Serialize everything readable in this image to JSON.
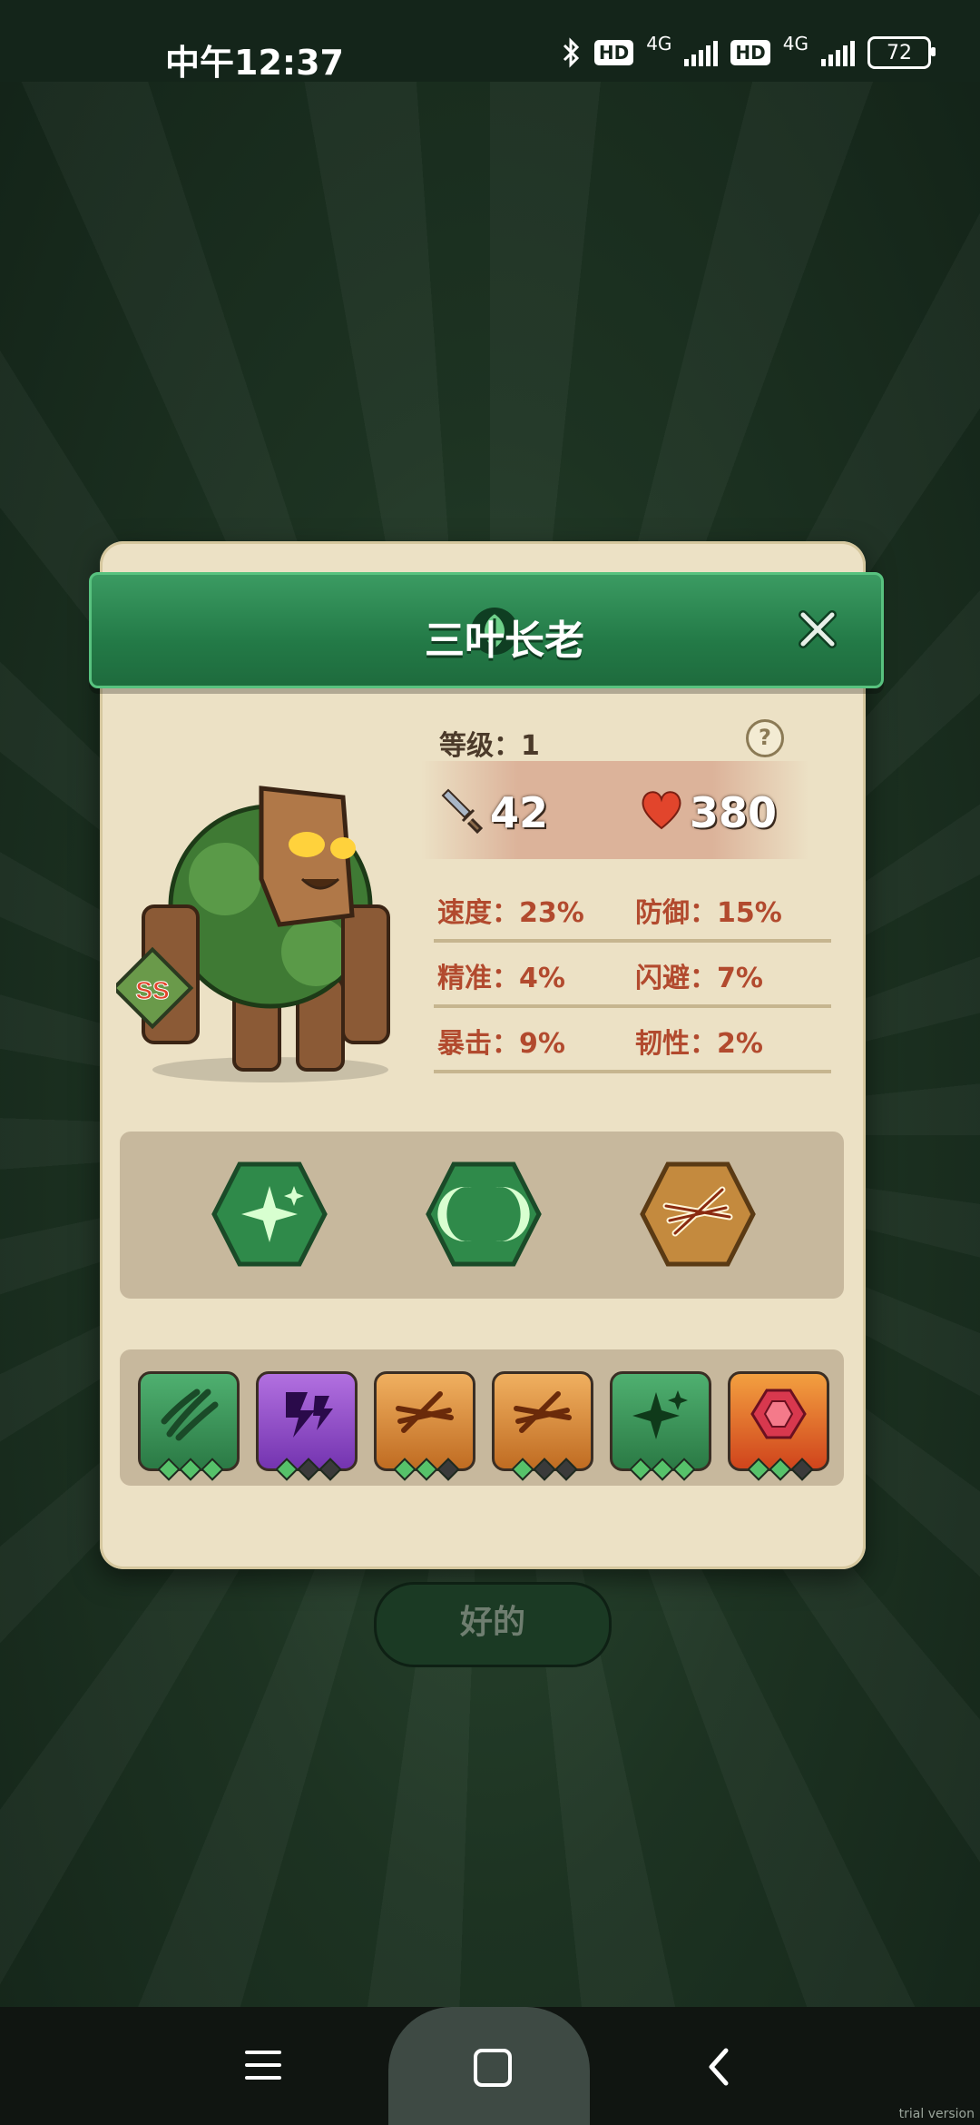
{
  "status_bar": {
    "time": "中午12:37",
    "hd1": "HD",
    "net1": "4G",
    "hd2": "HD",
    "net2": "4G",
    "battery": "72",
    "icons": [
      "bluetooth-icon",
      "signal-icon",
      "battery-icon"
    ]
  },
  "dialog": {
    "title": "三叶长老",
    "title_icon": "leaf-icon",
    "level_text": "等级：1",
    "help_label": "?",
    "attack": "42",
    "hp": "380",
    "stats": [
      {
        "left": "速度：23%",
        "right": "防御：15%"
      },
      {
        "left": "精准：4%",
        "right": "闪避：7%"
      },
      {
        "left": "暴击：9%",
        "right": "韧性：2%"
      }
    ],
    "rank_badge": "SS",
    "skills": [
      "sparkle-skill-icon",
      "twin-moon-skill-icon",
      "cross-slash-skill-icon"
    ],
    "equipment": [
      {
        "icon": "claw-slash-icon",
        "color": "green",
        "stars": 3
      },
      {
        "icon": "lightning-icon",
        "color": "purple",
        "stars": 1
      },
      {
        "icon": "cross-slash-icon",
        "color": "orange",
        "stars": 2
      },
      {
        "icon": "cross-slash-icon",
        "color": "orange",
        "stars": 1
      },
      {
        "icon": "sparkle-icon",
        "color": "green",
        "stars": 3
      },
      {
        "icon": "gem-icon",
        "color": "red",
        "stars": 2
      }
    ]
  },
  "ok_button": "好的",
  "watermark": "trial version",
  "colors": {
    "banner_green": "#237a47",
    "panel_beige": "#ece1c5",
    "stat_red": "#b24a2e"
  }
}
